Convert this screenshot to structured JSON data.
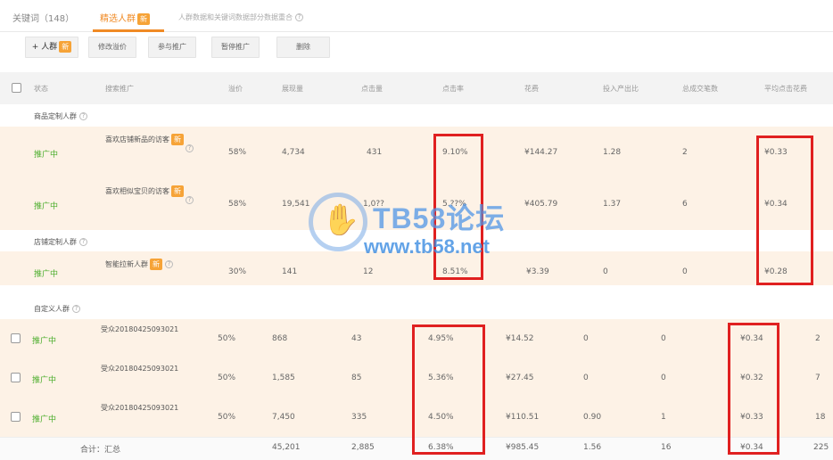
{
  "tabs": [
    {
      "label": "关键词（148）"
    },
    {
      "label": "精选人群"
    }
  ],
  "tab_hint": "人群数据和关键词数据部分数据重合",
  "new_badge": "新",
  "toolbar": {
    "add_label": "+ 人群",
    "modify_price_label": "修改溢价",
    "join_label": "参与推广",
    "pause_label": "暂停推广",
    "delete_label": "删除"
  },
  "columns": [
    "状态",
    "搜索推广",
    "溢价",
    "展现量",
    "点击量",
    "点击率",
    "花费",
    "投入产出比",
    "总成交笔数",
    "平均点击花费"
  ],
  "groups": {
    "product": "商品定制人群",
    "store": "店铺定制人群",
    "custom": "自定义人群"
  },
  "product_rows": [
    {
      "status": "推广中",
      "name": "喜欢店铺新品的访客",
      "premium": "58%",
      "impressions": "4,734",
      "clicks": "431",
      "ctr": "9.10%",
      "cost": "¥144.27",
      "roi": "1.28",
      "orders": "2",
      "cpc": "¥0.33"
    },
    {
      "status": "推广中",
      "name": "喜欢相似宝贝的访客",
      "premium": "58%",
      "impressions": "19,541",
      "clicks": "1,0??",
      "ctr": "5.??%",
      "cost": "¥405.79",
      "roi": "1.37",
      "orders": "6",
      "cpc": "¥0.34"
    }
  ],
  "store_rows": [
    {
      "status": "推广中",
      "name": "智能拉新人群",
      "premium": "30%",
      "impressions": "141",
      "clicks": "12",
      "ctr": "8.51%",
      "cost": "¥3.39",
      "roi": "0",
      "orders": "0",
      "cpc": "¥0.28"
    }
  ],
  "custom_rows": [
    {
      "status": "推广中",
      "name": "受众20180425093021",
      "premium": "50%",
      "impressions": "868",
      "clicks": "43",
      "ctr": "4.95%",
      "cost": "¥14.52",
      "roi": "0",
      "orders": "0",
      "cpc": "¥0.34",
      "extra": "2"
    },
    {
      "status": "推广中",
      "name": "受众20180425093021",
      "premium": "50%",
      "impressions": "1,585",
      "clicks": "85",
      "ctr": "5.36%",
      "cost": "¥27.45",
      "roi": "0",
      "orders": "0",
      "cpc": "¥0.32",
      "extra": "7"
    },
    {
      "status": "推广中",
      "name": "受众20180425093021",
      "premium": "50%",
      "impressions": "7,450",
      "clicks": "335",
      "ctr": "4.50%",
      "cost": "¥110.51",
      "roi": "0.90",
      "orders": "1",
      "cpc": "¥0.33",
      "extra": "18"
    }
  ],
  "total": {
    "label": "合计：汇总",
    "impressions": "45,201",
    "clicks": "2,885",
    "ctr": "6.38%",
    "cost": "¥985.45",
    "roi": "1.56",
    "orders": "16",
    "cpc": "¥0.34",
    "extra": "225"
  },
  "watermark": {
    "title": "TB58论坛",
    "url": "www.tb58.net"
  },
  "colors": {
    "accent": "#f08a24",
    "status_green": "#4cae2c",
    "highlight_red": "#e02020",
    "row_highlight": "#fdf2e6"
  }
}
